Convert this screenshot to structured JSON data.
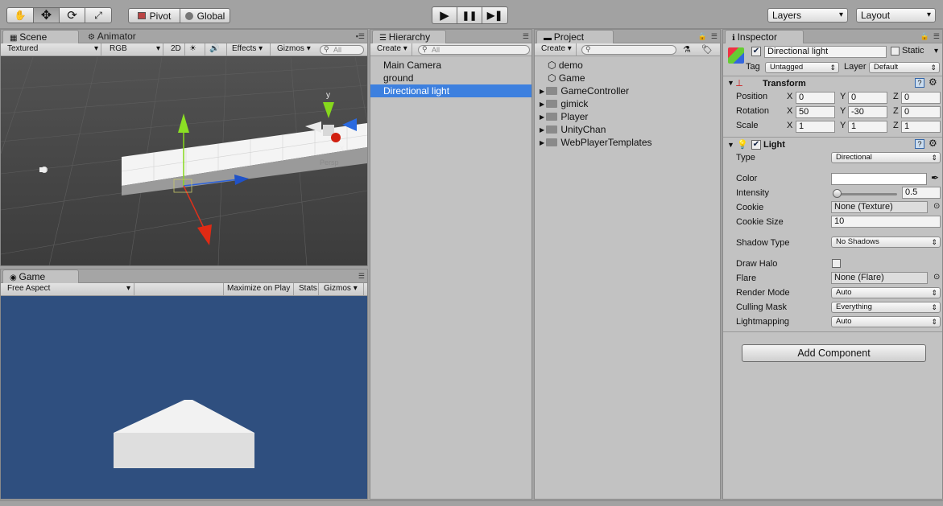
{
  "toolbar": {
    "tools": [
      {
        "name": "hand-tool-icon",
        "glyph": "✋"
      },
      {
        "name": "move-tool-icon",
        "glyph": "✥"
      },
      {
        "name": "rotate-tool-icon",
        "glyph": "⟳"
      },
      {
        "name": "scale-tool-icon",
        "glyph": "⤢"
      }
    ],
    "pivot": "Pivot",
    "global": "Global",
    "play": "▶",
    "pause": "❚❚",
    "step": "▶❚",
    "layers": "Layers",
    "layout": "Layout"
  },
  "scene": {
    "tab": "Scene",
    "tab2": "Animator",
    "textured": "Textured",
    "rgb": "RGB",
    "mode2d": "2D",
    "effects": "Effects",
    "gizmos": "Gizmos",
    "search_placeholder": "All",
    "axis_y": "y",
    "axis_x": "x",
    "persp": "Persp"
  },
  "game": {
    "tab": "Game",
    "aspect": "Free Aspect",
    "maximize": "Maximize on Play",
    "stats": "Stats",
    "gizmos": "Gizmos",
    "background": "#2f4f7f"
  },
  "hierarchy": {
    "tab": "Hierarchy",
    "create": "Create",
    "search_placeholder": "All",
    "items": [
      "Main Camera",
      "ground",
      "Directional light"
    ],
    "selected_index": 2
  },
  "project": {
    "tab": "Project",
    "create": "Create",
    "scenes": [
      "demo",
      "Game"
    ],
    "folders": [
      "GameController",
      "gimick",
      "Player",
      "UnityChan",
      "WebPlayerTemplates"
    ]
  },
  "inspector": {
    "tab": "Inspector",
    "object_name": "Directional light",
    "static_label": "Static",
    "tag_label": "Tag",
    "tag_value": "Untagged",
    "layer_label": "Layer",
    "layer_value": "Default",
    "transform": {
      "title": "Transform",
      "rows": [
        {
          "label": "Position",
          "x": "0",
          "y": "0",
          "z": "0"
        },
        {
          "label": "Rotation",
          "x": "50",
          "y": "-30",
          "z": "0"
        },
        {
          "label": "Scale",
          "x": "1",
          "y": "1",
          "z": "1"
        }
      ],
      "x_label": "X",
      "y_label": "Y",
      "z_label": "Z"
    },
    "light": {
      "title": "Light",
      "type_label": "Type",
      "type_value": "Directional",
      "color_label": "Color",
      "intensity_label": "Intensity",
      "intensity_value": "0.5",
      "intensity_fraction": 0.06,
      "cookie_label": "Cookie",
      "cookie_value": "None (Texture)",
      "cookie_size_label": "Cookie Size",
      "cookie_size_value": "10",
      "shadow_label": "Shadow Type",
      "shadow_value": "No Shadows",
      "halo_label": "Draw Halo",
      "flare_label": "Flare",
      "flare_value": "None (Flare)",
      "render_label": "Render Mode",
      "render_value": "Auto",
      "culling_label": "Culling Mask",
      "culling_value": "Everything",
      "lightmap_label": "Lightmapping",
      "lightmap_value": "Auto"
    },
    "add_component": "Add Component"
  },
  "colors": {
    "selection": "#3d80df",
    "gizmo_y": "#88dd22",
    "gizmo_x": "#e0301a",
    "gizmo_z": "#2a6ae0"
  }
}
